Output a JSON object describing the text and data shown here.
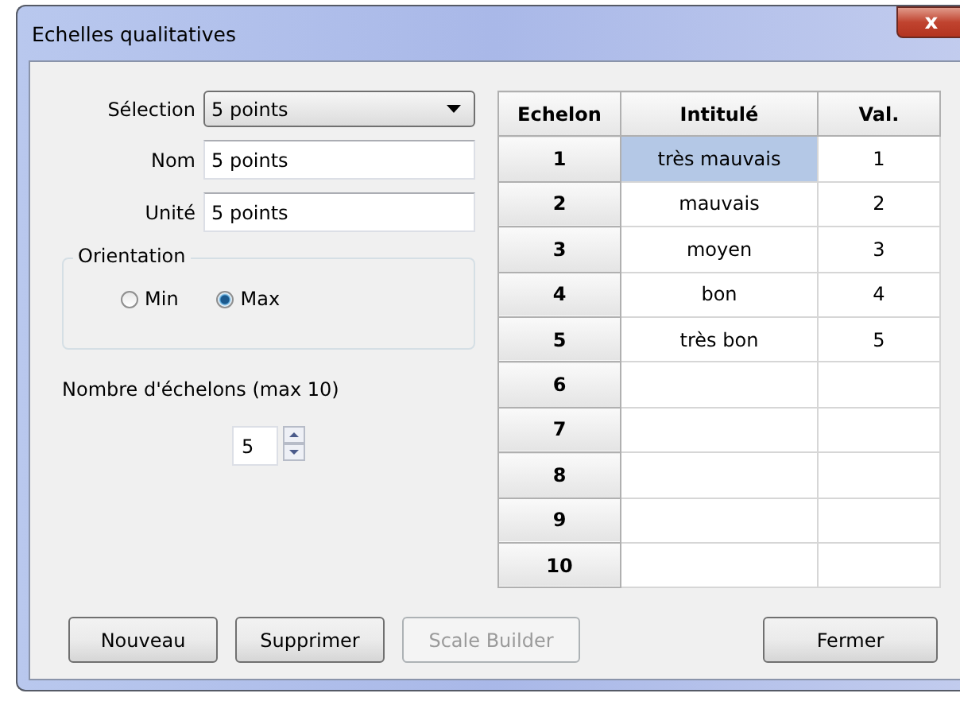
{
  "window": {
    "title": "Echelles qualitatives",
    "close": "x"
  },
  "form": {
    "selection": {
      "label": "Sélection",
      "value": "5 points"
    },
    "nom": {
      "label": "Nom",
      "value": "5 points"
    },
    "unite": {
      "label": "Unité",
      "value": "5 points"
    },
    "orientation": {
      "title": "Orientation",
      "options": [
        {
          "label": "Min",
          "selected": false
        },
        {
          "label": "Max",
          "selected": true
        }
      ]
    },
    "steps": {
      "label": "Nombre d'échelons (max 10)",
      "value": "5"
    }
  },
  "table": {
    "columns": [
      "Echelon",
      "Intitulé",
      "Val."
    ],
    "rows": [
      {
        "echelon": "1",
        "intitule": "très mauvais",
        "val": "1",
        "selected": true
      },
      {
        "echelon": "2",
        "intitule": "mauvais",
        "val": "2",
        "selected": false
      },
      {
        "echelon": "3",
        "intitule": "moyen",
        "val": "3",
        "selected": false
      },
      {
        "echelon": "4",
        "intitule": "bon",
        "val": "4",
        "selected": false
      },
      {
        "echelon": "5",
        "intitule": "très bon",
        "val": "5",
        "selected": false
      },
      {
        "echelon": "6",
        "selected": false
      },
      {
        "echelon": "7",
        "selected": false
      },
      {
        "echelon": "8",
        "selected": false
      },
      {
        "echelon": "9",
        "selected": false
      },
      {
        "echelon": "10",
        "selected": false
      }
    ]
  },
  "buttons": [
    {
      "label": "Nouveau",
      "disabled": false
    },
    {
      "label": "Supprimer",
      "disabled": false
    },
    {
      "label": "Scale Builder",
      "disabled": true
    },
    {
      "label": "Fermer",
      "disabled": false
    }
  ]
}
